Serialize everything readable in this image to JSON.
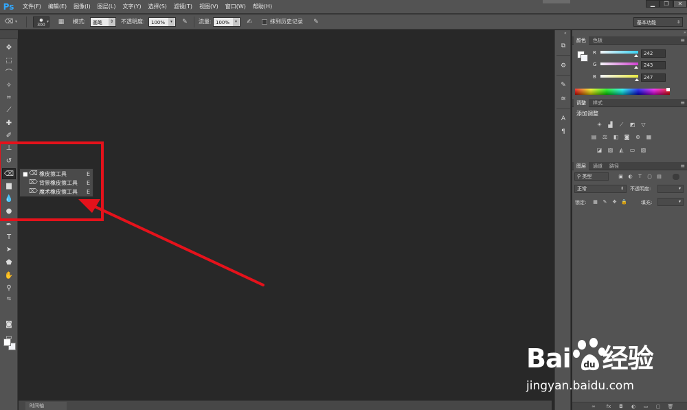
{
  "app": {
    "logo": "Ps"
  },
  "menu": [
    "文件(F)",
    "编辑(E)",
    "图像(I)",
    "图层(L)",
    "文字(Y)",
    "选择(S)",
    "滤镜(T)",
    "视图(V)",
    "窗口(W)",
    "帮助(H)"
  ],
  "window_controls": {
    "minimize": "▁",
    "restore": "❐",
    "close": "✕"
  },
  "options_bar": {
    "brush_size": "300",
    "mode_label": "模式:",
    "mode_value": "画笔",
    "opacity_label": "不透明度:",
    "opacity_value": "100%",
    "flow_label": "流量:",
    "flow_value": "100%",
    "history_label": "抹到历史记录",
    "workspace": "基本功能"
  },
  "flyout": {
    "items": [
      {
        "label": "橡皮擦工具",
        "shortcut": "E",
        "selected": true
      },
      {
        "label": "背景橡皮擦工具",
        "shortcut": "E",
        "selected": false
      },
      {
        "label": "魔术橡皮擦工具",
        "shortcut": "E",
        "selected": false
      }
    ]
  },
  "panels": {
    "color": {
      "tabs": [
        "颜色",
        "色板"
      ],
      "channels": [
        {
          "name": "R",
          "value": "242",
          "fraction": 0.949,
          "color": "#38d0f0"
        },
        {
          "name": "G",
          "value": "243",
          "fraction": 0.953,
          "color": "#d040d0"
        },
        {
          "name": "B",
          "value": "247",
          "fraction": 0.969,
          "color": "#e8e840"
        }
      ],
      "foreground": "#ffffff",
      "background": "#f2f3f7"
    },
    "adjustments": {
      "tabs": [
        "调整",
        "样式"
      ],
      "title": "添加调整"
    },
    "layers": {
      "tabs": [
        "图层",
        "通道",
        "路径"
      ],
      "filter_label": "类型",
      "blend_mode": "正常",
      "opacity_label": "不透明度:",
      "lock_label": "锁定:",
      "fill_label": "填充:"
    }
  },
  "timeline": {
    "label": "时间轴"
  },
  "watermark": {
    "brand_left": "Bai",
    "brand_right": "经验",
    "url": "jingyan.baidu.com"
  },
  "colors": {
    "accent_red": "#e5121b",
    "ps_blue": "#31a8ff"
  }
}
